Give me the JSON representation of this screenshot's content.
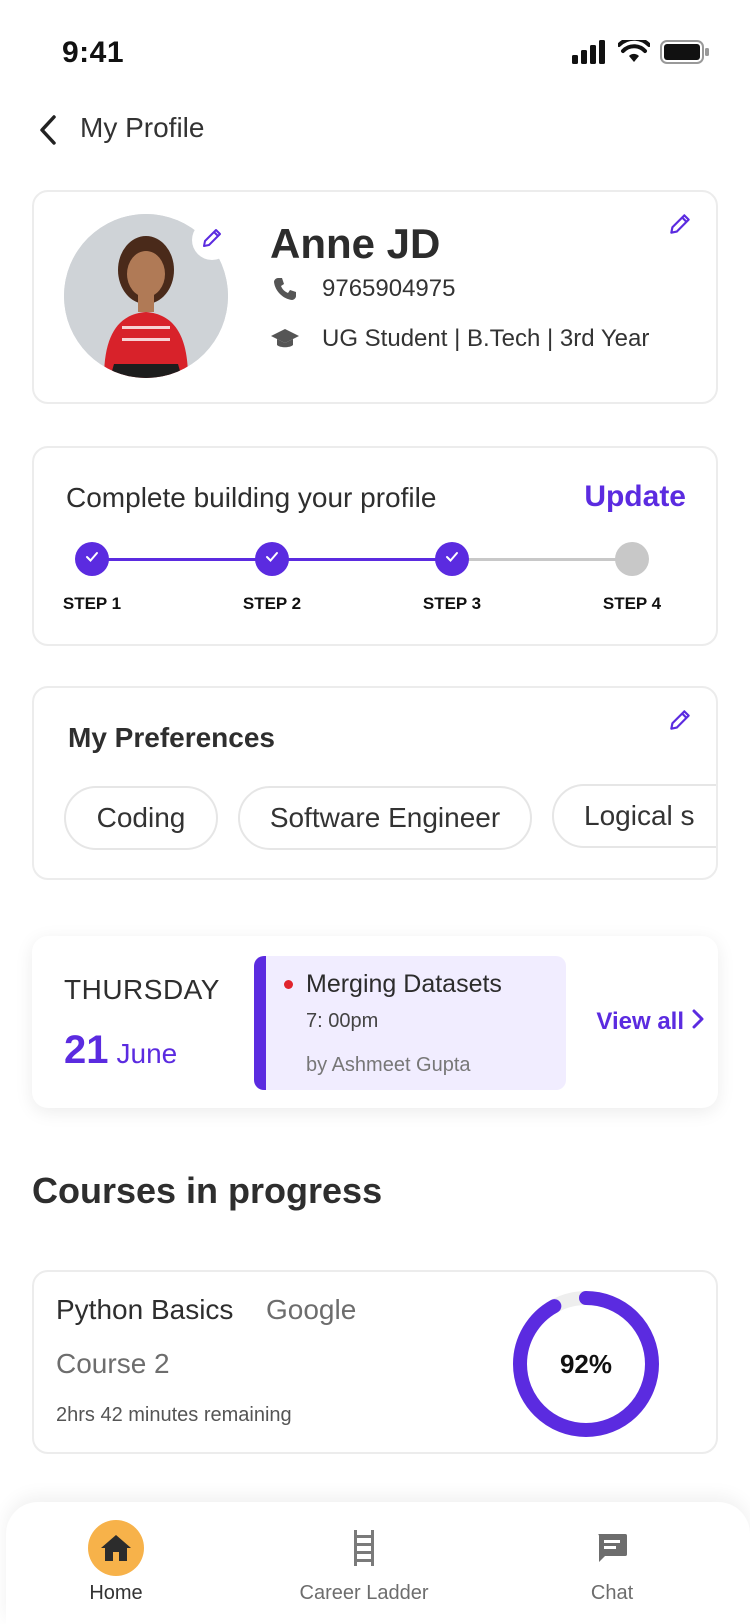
{
  "status_bar": {
    "time": "9:41"
  },
  "header": {
    "title": "My Profile"
  },
  "profile": {
    "name": "Anne JD",
    "phone": "9765904975",
    "education": "UG Student | B.Tech | 3rd Year"
  },
  "profile_progress": {
    "title": "Complete building your profile",
    "update_label": "Update",
    "progress_fraction": 0.75,
    "steps": [
      {
        "label": "STEP 1",
        "done": true
      },
      {
        "label": "STEP 2",
        "done": true
      },
      {
        "label": "STEP 3",
        "done": true
      },
      {
        "label": "STEP 4",
        "done": false
      }
    ]
  },
  "preferences": {
    "title": "My Preferences",
    "chips": [
      "Coding",
      "Software Engineer",
      "Logical s"
    ]
  },
  "schedule": {
    "day": "THURSDAY",
    "date_num": "21",
    "month": "June",
    "event": {
      "title": "Merging Datasets",
      "time": "7: 00pm",
      "by": "by Ashmeet Gupta"
    },
    "view_all_label": "View all"
  },
  "courses": {
    "section_title": "Courses in progress",
    "items": [
      {
        "name": "Python Basics",
        "provider": "Google",
        "subtitle": "Course 2",
        "remaining": "2hrs 42 minutes remaining",
        "progress_label": "92%",
        "progress": 0.92
      }
    ]
  },
  "bottom_nav": {
    "items": [
      {
        "label": "Home",
        "icon": "home-icon",
        "active": true
      },
      {
        "label": "Career Ladder",
        "icon": "ladder-icon",
        "active": false
      },
      {
        "label": "Chat",
        "icon": "chat-icon",
        "active": false
      }
    ]
  },
  "colors": {
    "accent": "#5b2be0",
    "accent_light": "#f1edff",
    "nav_active": "#f7b24a",
    "inactive_step": "#c8c8c8",
    "event_dot": "#e0242d"
  }
}
